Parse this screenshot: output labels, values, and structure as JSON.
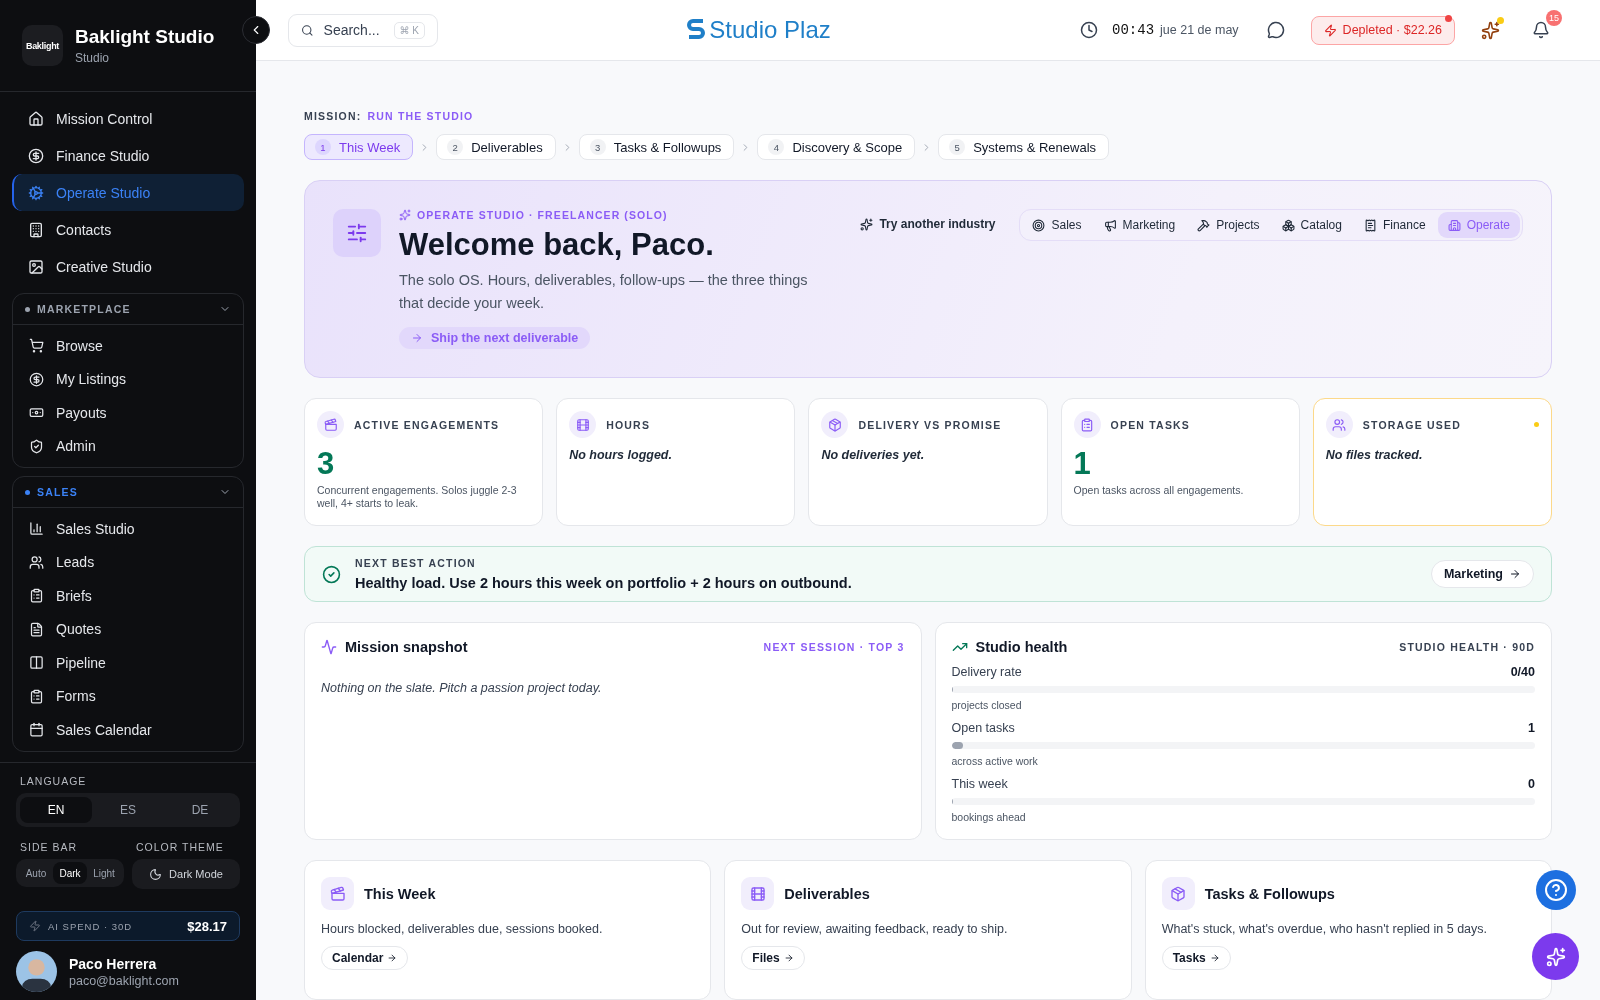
{
  "sidebar": {
    "brand": {
      "logo": "Baklight",
      "name": "Baklight Studio",
      "subtitle": "Studio"
    },
    "nav": [
      {
        "label": "Mission Control",
        "selected": false
      },
      {
        "label": "Finance Studio",
        "selected": false
      },
      {
        "label": "Operate Studio",
        "selected": true
      },
      {
        "label": "Contacts",
        "selected": false
      },
      {
        "label": "Creative Studio",
        "selected": false
      }
    ],
    "groups": [
      {
        "title": "MARKETPLACE",
        "color": "#9ca3af",
        "items": [
          "Browse",
          "My Listings",
          "Payouts",
          "Admin"
        ]
      },
      {
        "title": "SALES",
        "color": "#3b82f6",
        "items": [
          "Sales Studio",
          "Leads",
          "Briefs",
          "Quotes",
          "Pipeline",
          "Forms",
          "Sales Calendar"
        ]
      }
    ],
    "language": {
      "label": "LANGUAGE",
      "options": [
        {
          "label": "EN",
          "selected": true
        },
        {
          "label": "ES",
          "selected": false
        },
        {
          "label": "DE",
          "selected": false
        }
      ]
    },
    "sidebar_mode": {
      "label": "SIDE BAR",
      "options": [
        {
          "label": "Auto",
          "selected": false
        },
        {
          "label": "Dark",
          "selected": true
        },
        {
          "label": "Light",
          "selected": false
        }
      ]
    },
    "color_theme": {
      "label": "COLOR THEME",
      "button": "Dark Mode"
    },
    "ai_spend": {
      "label": "AI SPEND · 30D",
      "value": "$28.17"
    },
    "user": {
      "name": "Paco Herrera",
      "email": "paco@baklight.com"
    }
  },
  "topbar": {
    "search": {
      "placeholder": "Search...",
      "shortcut": "⌘ K"
    },
    "brand": "Studio Plaz",
    "timer": "00:43",
    "date": "jue 21 de may",
    "credit": "Depleted · $22.26",
    "notifications": "15"
  },
  "mission": {
    "label": "MISSION:",
    "name": "RUN THE STUDIO",
    "steps": [
      {
        "number": "1",
        "label": "This Week",
        "selected": true
      },
      {
        "number": "2",
        "label": "Deliverables",
        "selected": false
      },
      {
        "number": "3",
        "label": "Tasks & Followups",
        "selected": false
      },
      {
        "number": "4",
        "label": "Discovery & Scope",
        "selected": false
      },
      {
        "number": "5",
        "label": "Systems & Renewals",
        "selected": false
      }
    ]
  },
  "hero": {
    "eyebrow": "OPERATE STUDIO · FREELANCER (SOLO)",
    "title": "Welcome back, Paco.",
    "subtitle": "The solo OS. Hours, deliverables, follow-ups — the three things that decide your week.",
    "cta": "Ship the next deliverable",
    "try_label": "Try another industry",
    "industries": [
      {
        "label": "Sales",
        "selected": false
      },
      {
        "label": "Marketing",
        "selected": false
      },
      {
        "label": "Projects",
        "selected": false
      },
      {
        "label": "Catalog",
        "selected": false
      },
      {
        "label": "Finance",
        "selected": false
      },
      {
        "label": "Operate",
        "selected": true
      }
    ]
  },
  "kpis": [
    {
      "kind": "value",
      "title": "ACTIVE ENGAGEMENTS",
      "value": "3",
      "caption": "Concurrent engagements. Solos juggle 2-3 well, 4+ starts to leak.",
      "highlighted": false
    },
    {
      "kind": "empty",
      "title": "HOURS",
      "caption": "No hours logged.",
      "highlighted": false
    },
    {
      "kind": "empty",
      "title": "DELIVERY VS PROMISE",
      "caption": "No deliveries yet.",
      "highlighted": false
    },
    {
      "kind": "value",
      "title": "OPEN TASKS",
      "value": "1",
      "caption": "Open tasks across all engagements.",
      "highlighted": false
    },
    {
      "kind": "empty",
      "title": "STORAGE USED",
      "caption": "No files tracked.",
      "highlighted": true
    }
  ],
  "next_action": {
    "label": "NEXT BEST ACTION",
    "text": "Healthy load. Use 2 hours this week on portfolio + 2 hours on outbound.",
    "button": "Marketing"
  },
  "snapshot": {
    "title": "Mission snapshot",
    "tag": "NEXT SESSION · TOP 3",
    "empty": "Nothing on the slate. Pitch a passion project today."
  },
  "health": {
    "title": "Studio health",
    "tag": "STUDIO HEALTH · 90D",
    "metrics": [
      {
        "label": "Delivery rate",
        "value": "0/40",
        "level": 0,
        "caption": "projects closed"
      },
      {
        "label": "Open tasks",
        "value": "1",
        "level": 0.02,
        "caption": "across active work"
      },
      {
        "label": "This week",
        "value": "0",
        "level": 0,
        "caption": "bookings ahead"
      }
    ]
  },
  "modules": [
    {
      "title": "This Week",
      "description": "Hours blocked, deliverables due, sessions booked.",
      "button": "Calendar"
    },
    {
      "title": "Deliverables",
      "description": "Out for review, awaiting feedback, ready to ship.",
      "button": "Files"
    },
    {
      "title": "Tasks & Followups",
      "description": "What's stuck, what's overdue, who hasn't replied in 5 days.",
      "button": "Tasks"
    }
  ]
}
